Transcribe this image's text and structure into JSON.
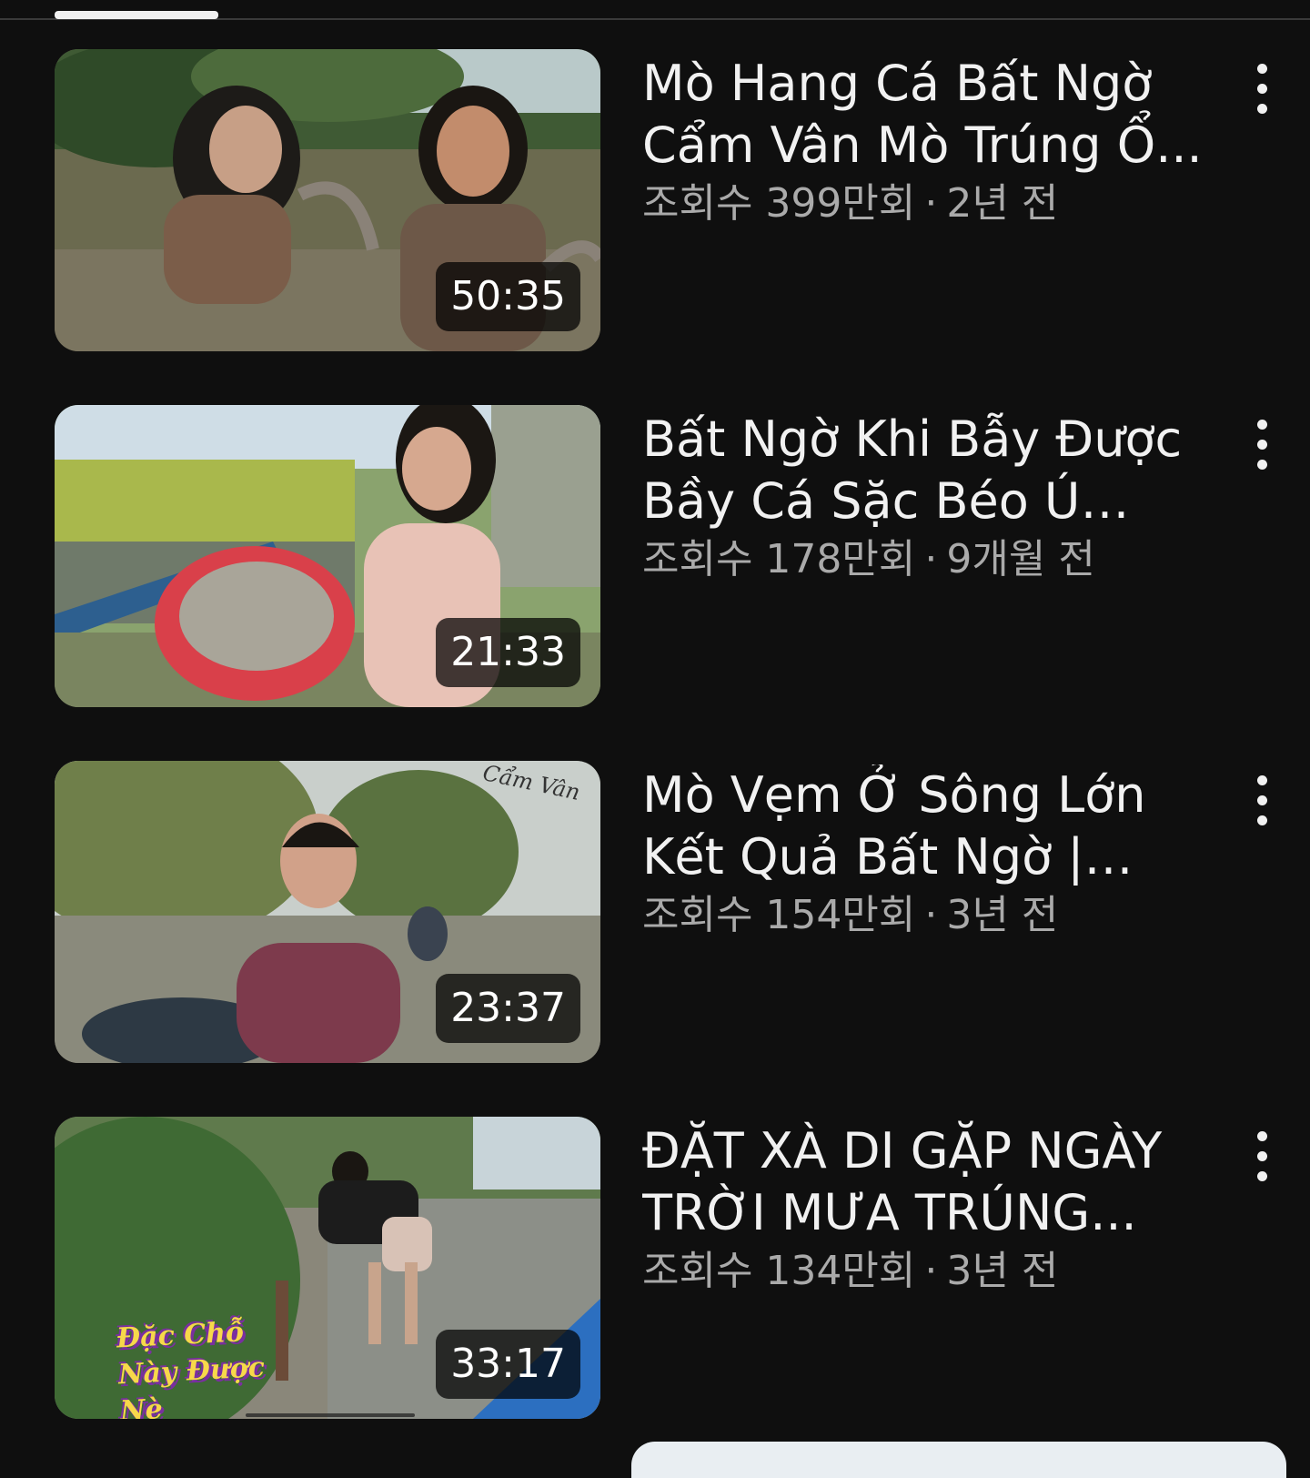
{
  "videos": [
    {
      "title": "Mò Hang Cá Bất Ngờ Cẩm Vân Mò Trúng Ổ...",
      "views": "조회수 399만회",
      "age": "2년 전",
      "duration": "50:35"
    },
    {
      "title": "Bất Ngờ Khi Bẫy Được Bầy Cá Sặc Béo Ú Sau...",
      "views": "조회수 178만회",
      "age": "9개월 전",
      "duration": "21:33"
    },
    {
      "title": "Mò Vẹm Ở Sông Lớn Kết Quả Bất Ngờ | Cẩm Vâ...",
      "views": "조회수 154만회",
      "age": "3년 전",
      "duration": "23:37",
      "thumb_logo": "Cẩm Vân"
    },
    {
      "title": "ĐẶT XÀ DI GẶP NGÀY TRỜI MƯA TRÚNG...",
      "views": "조회수 134만회",
      "age": "3년 전",
      "duration": "33:17",
      "thumb_caption": "Đặc Chỗ Này Được Nè"
    }
  ],
  "separator": "·",
  "icons": {
    "more": "more-vert-icon"
  },
  "colors": {
    "background": "#0f0f0f",
    "title": "#f1f1f1",
    "meta": "#aaaaaa"
  }
}
